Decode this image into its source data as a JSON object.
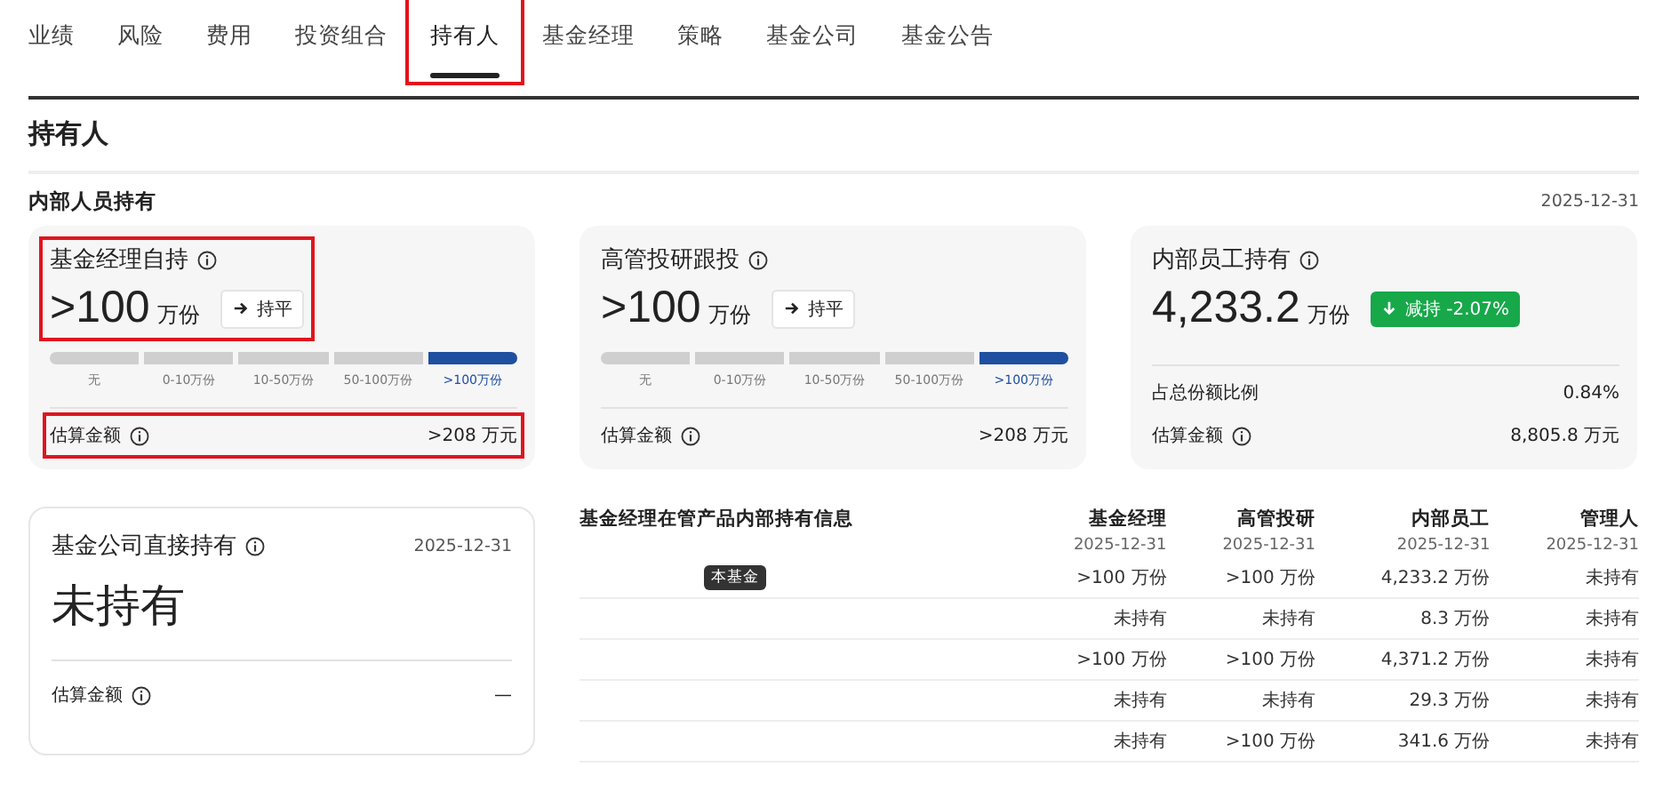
{
  "tabs": [
    {
      "label": "业绩",
      "selected": false,
      "highlighted": false
    },
    {
      "label": "风险",
      "selected": false,
      "highlighted": false
    },
    {
      "label": "费用",
      "selected": false,
      "highlighted": false
    },
    {
      "label": "投资组合",
      "selected": false,
      "highlighted": false
    },
    {
      "label": "持有人",
      "selected": true,
      "highlighted": true
    },
    {
      "label": "基金经理",
      "selected": false,
      "highlighted": false
    },
    {
      "label": "策略",
      "selected": false,
      "highlighted": false
    },
    {
      "label": "基金公司",
      "selected": false,
      "highlighted": false
    },
    {
      "label": "基金公告",
      "selected": false,
      "highlighted": false
    }
  ],
  "page_title": "持有人",
  "section": {
    "title": "内部人员持有",
    "date": "2025-12-31"
  },
  "cards": [
    {
      "kind": "range",
      "title": "基金经理自持",
      "highlighted": true,
      "value": ">100",
      "unit": "万份",
      "trend": {
        "kind": "flat",
        "label": "持平"
      },
      "ranges": [
        {
          "label": "无",
          "selected": false
        },
        {
          "label": "0-10万份",
          "selected": false
        },
        {
          "label": "10-50万份",
          "selected": false
        },
        {
          "label": "50-100万份",
          "selected": false
        },
        {
          "label": ">100万份",
          "selected": true
        }
      ],
      "rows": [
        {
          "label": "估算金额",
          "info": true,
          "value": ">208 万元",
          "highlighted": true
        }
      ]
    },
    {
      "kind": "range",
      "title": "高管投研跟投",
      "highlighted": false,
      "value": ">100",
      "unit": "万份",
      "trend": {
        "kind": "flat",
        "label": "持平"
      },
      "ranges": [
        {
          "label": "无",
          "selected": false
        },
        {
          "label": "0-10万份",
          "selected": false
        },
        {
          "label": "10-50万份",
          "selected": false
        },
        {
          "label": "50-100万份",
          "selected": false
        },
        {
          "label": ">100万份",
          "selected": true
        }
      ],
      "rows": [
        {
          "label": "估算金额",
          "info": true,
          "value": ">208 万元",
          "highlighted": false
        }
      ]
    },
    {
      "kind": "plain",
      "title": "内部员工持有",
      "highlighted": false,
      "value": "4,233.2",
      "unit": "万份",
      "trend": {
        "kind": "down",
        "label": "减持 -2.07%"
      },
      "rows": [
        {
          "label": "占总份额比例",
          "info": false,
          "value": "0.84%",
          "highlighted": false
        },
        {
          "label": "估算金额",
          "info": true,
          "value": "8,805.8 万元",
          "highlighted": false
        }
      ]
    }
  ],
  "company": {
    "title": "基金公司直接持有",
    "date": "2025-12-31",
    "value": "未持有",
    "rows": [
      {
        "label": "估算金额",
        "info": true,
        "value": "—"
      }
    ]
  },
  "table": {
    "title": "基金经理在管产品内部持有信息",
    "columns": [
      {
        "label": "基金经理",
        "date": "2025-12-31"
      },
      {
        "label": "高管投研",
        "date": "2025-12-31"
      },
      {
        "label": "内部员工",
        "date": "2025-12-31"
      },
      {
        "label": "管理人",
        "date": "2025-12-31"
      }
    ],
    "rows": [
      {
        "badge": "本基金",
        "cells": [
          ">100 万份",
          ">100 万份",
          "4,233.2 万份",
          "未持有"
        ]
      },
      {
        "cells": [
          "未持有",
          "未持有",
          "8.3 万份",
          "未持有"
        ]
      },
      {
        "cells": [
          ">100 万份",
          ">100 万份",
          "4,371.2 万份",
          "未持有"
        ]
      },
      {
        "cells": [
          "未持有",
          "未持有",
          "29.3 万份",
          "未持有"
        ]
      },
      {
        "cells": [
          "未持有",
          ">100 万份",
          "341.6 万份",
          "未持有"
        ]
      }
    ]
  }
}
